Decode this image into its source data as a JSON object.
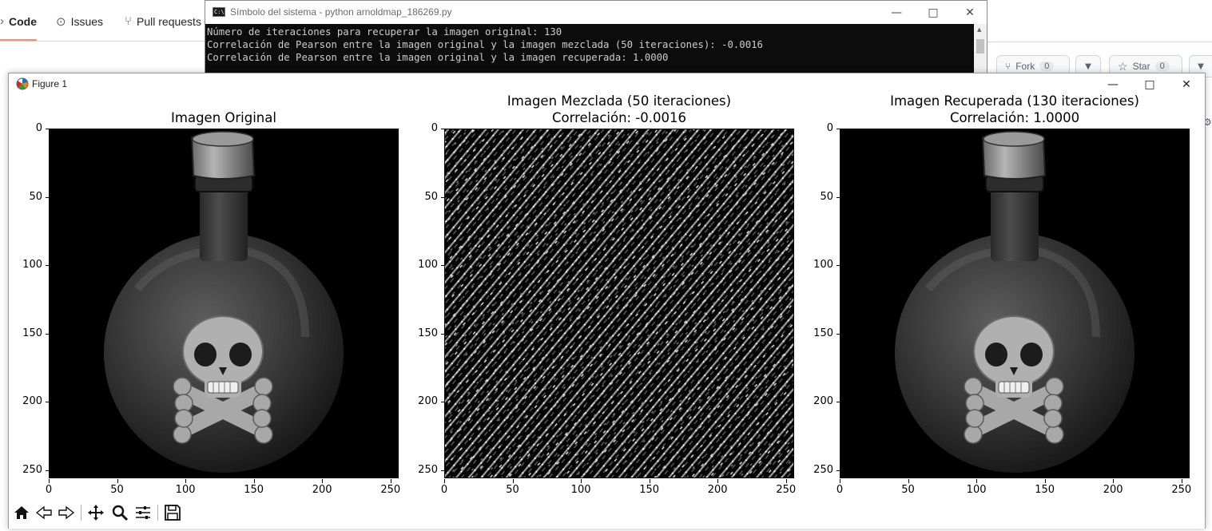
{
  "github": {
    "tabs": [
      {
        "label": "Code",
        "icon": "code-icon"
      },
      {
        "label": "Issues",
        "icon": "issue-icon"
      },
      {
        "label": "Pull requests",
        "icon": "pull-request-icon"
      }
    ],
    "fork_label": "Fork",
    "fork_count": "0",
    "star_label": "Star",
    "star_count": "0"
  },
  "console": {
    "title": "Símbolo del sistema - python  arnoldmap_186269.py",
    "lines": [
      "Número de iteraciones para recuperar la imagen original: 130",
      "Correlación de Pearson entre la imagen original y la imagen mezclada (50 iteraciones): -0.0016",
      "Correlación de Pearson entre la imagen original y la imagen recuperada: 1.0000"
    ]
  },
  "figure": {
    "title": "Figure 1",
    "panels": [
      {
        "title_line1": "Imagen Original",
        "title_line2": "",
        "content": "poison-bottle-image"
      },
      {
        "title_line1": "Imagen Mezclada (50 iteraciones)",
        "title_line2": "Correlación: -0.0016",
        "content": "scrambled-noise-image"
      },
      {
        "title_line1": "Imagen Recuperada (130 iteraciones)",
        "title_line2": "Correlación: 1.0000",
        "content": "poison-bottle-image"
      }
    ],
    "x_ticks": [
      "0",
      "50",
      "100",
      "150",
      "200",
      "250"
    ],
    "y_ticks": [
      "0",
      "50",
      "100",
      "150",
      "200",
      "250"
    ],
    "image_extent": [
      0,
      256
    ],
    "toolbar": [
      {
        "name": "home-button",
        "icon": "home-icon"
      },
      {
        "name": "back-button",
        "icon": "arrow-left-icon"
      },
      {
        "name": "forward-button",
        "icon": "arrow-right-icon"
      },
      {
        "name": "pan-button",
        "icon": "move-icon"
      },
      {
        "name": "zoom-button",
        "icon": "zoom-icon"
      },
      {
        "name": "configure-subplots-button",
        "icon": "sliders-icon"
      },
      {
        "name": "save-button",
        "icon": "save-icon"
      }
    ]
  },
  "colors": {
    "console_bg": "#0c0c0c",
    "console_text": "#cccccc",
    "code_tab_underline": "#fd8c73"
  }
}
